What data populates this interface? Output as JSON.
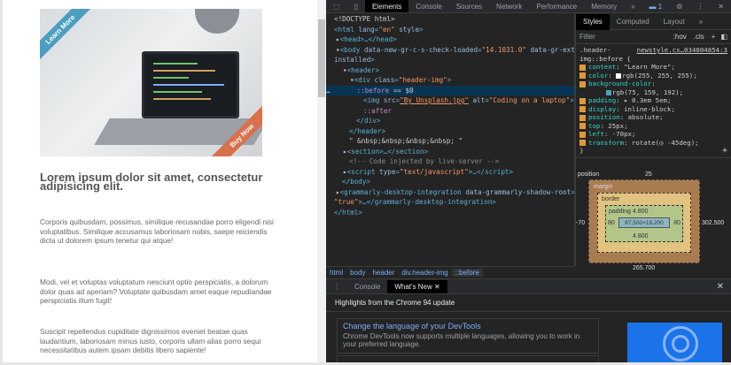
{
  "page": {
    "ribbon_left": "Learn More",
    "ribbon_right": "Buy Now",
    "heading": "Lorem ipsum dolor sit amet, consectetur adipisicing elit.",
    "paragraphs": [
      "Corporis quibusdam, possimus, similique recusandae porro eligendi nisi voluptatibus. Similique accusamus laboriosam nobis, saepe reiciendis dicta ut dolorem ipsum tenetur qui atque!",
      "Modi, vel et voluptas voluptatum nesciunt optio perspiciatis, a dolorum dolor quas ad aperiam? Voluptate quibusdam amet eaque repudiandae perspiciatis illum fugit!",
      "Suscipit repellendus cupiditate dignissimos eveniet beatae quas laudantium, laboriosam minus iusto, corporis ullam alias porro sequi necessitatibus autem ipsam debitis libero sapiente!"
    ]
  },
  "devtools": {
    "tabs": [
      "Elements",
      "Console",
      "Sources",
      "Network",
      "Performance",
      "Memory",
      "»"
    ],
    "issues_count": "1",
    "styles_tabs": [
      "Styles",
      "Computed",
      "Layout",
      "»"
    ],
    "filter_placeholder": "Filter",
    "hov": ":hov",
    "cls": ".cls",
    "rule": {
      "selector1": ".header-",
      "selector2": "img::before {",
      "source": "newstyle.cs…034804854:3",
      "props": [
        [
          "content",
          "\"Learn More\";"
        ],
        [
          "color",
          "rgb(255, 255, 255);"
        ],
        [
          "background-color",
          ""
        ],
        [
          "padding",
          "▸ 0.3em 5em;"
        ],
        [
          "display",
          "inline-block;"
        ],
        [
          "position",
          "absolute;"
        ],
        [
          "top",
          "25px;"
        ],
        [
          "left",
          "-70px;"
        ],
        [
          "transform",
          "rotate(◷ -45deg);"
        ]
      ],
      "bg_value": "rgb(75, 159, 192);",
      "close": "}"
    },
    "box": {
      "position_label": "position",
      "top": "25",
      "left": "-70",
      "right": "302.500",
      "bottom": "265.700",
      "margin": "margin",
      "border": "border",
      "padding": "padding",
      "pad_top": "4.800",
      "pad_bottom": "4.800",
      "pad_left": "80",
      "pad_right": "80",
      "dash": "–",
      "content": "87.500×19.200"
    },
    "crumbs": [
      "html",
      "body",
      "header",
      "div.header-img",
      "::before"
    ],
    "drawer_tabs": [
      "Console",
      "What's New"
    ],
    "highlights": "Highlights from the Chrome 94 update",
    "card_title": "Change the language of your DevTools",
    "card_text": "Chrome DevTools now supports multiple languages, allowing you to work in your preferred language.",
    "colors": {
      "ribbon_blue": "#4b9fc0",
      "ribbon_orange": "#d9704b",
      "selected_row": "#073655"
    }
  }
}
